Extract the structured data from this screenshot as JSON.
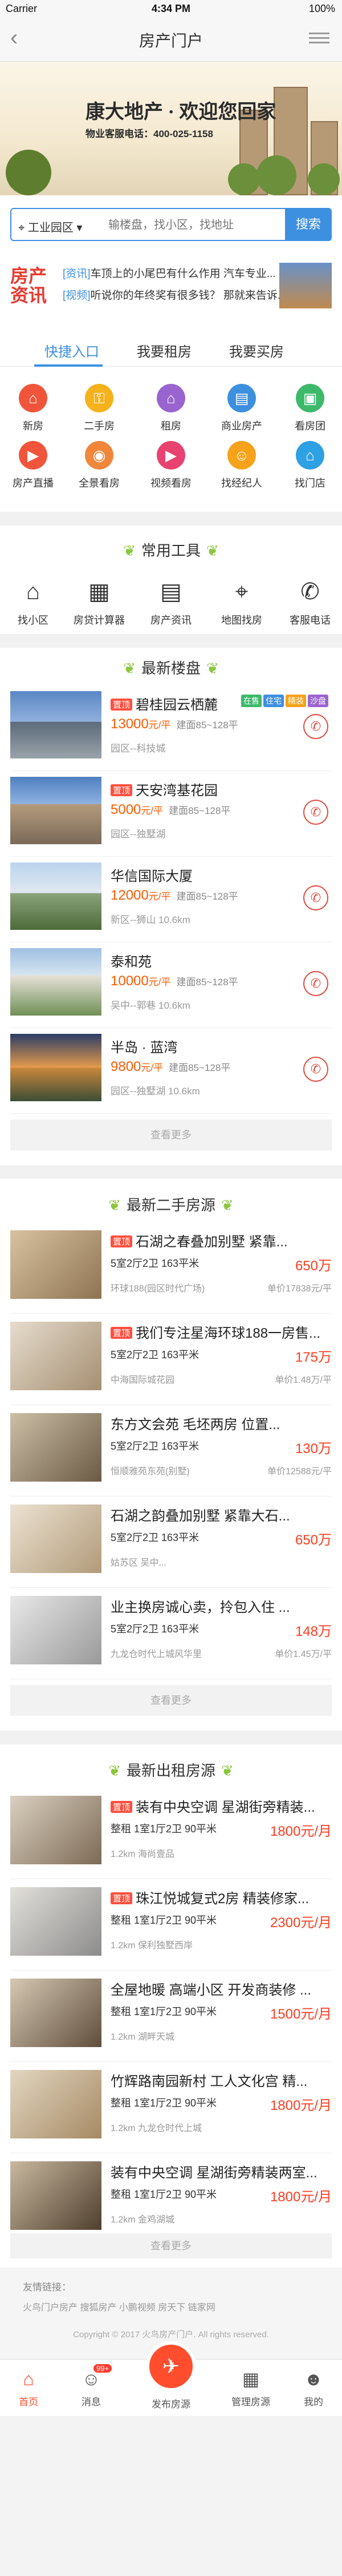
{
  "status": {
    "carrier": "Carrier",
    "time": "4:34 PM",
    "battery": "100%"
  },
  "nav": {
    "title": "房产门户",
    "back": "‹"
  },
  "banner": {
    "headline": "康大地产 · 欢迎您回家",
    "phone_line": "物业客服电话：400-025-1158"
  },
  "search": {
    "city": "工业园区",
    "placeholder": "输楼盘，找小区，找地址",
    "button": "搜索"
  },
  "news": {
    "logo": "房产资讯",
    "items": [
      {
        "tag": "[资讯]",
        "text": "车顶上的小尾巴有什么作用 汽车专业..."
      },
      {
        "tag": "[视频]",
        "text": "听说你的年终奖有很多钱？ 那就来告诉..."
      }
    ]
  },
  "tabs": [
    "快捷入口",
    "我要租房",
    "我要买房"
  ],
  "quick_icons": [
    {
      "label": "新房",
      "icon": "house-icon",
      "color": "#f0553b"
    },
    {
      "label": "二手房",
      "icon": "key-icon",
      "color": "#f6b21b"
    },
    {
      "label": "租房",
      "icon": "rent-icon",
      "color": "#9a64d0"
    },
    {
      "label": "商业房产",
      "icon": "shop-icon",
      "color": "#3d90e0"
    },
    {
      "label": "看房团",
      "icon": "bus-icon",
      "color": "#3db96b"
    },
    {
      "label": "房产直播",
      "icon": "live-icon",
      "color": "#f0553b"
    },
    {
      "label": "全景看房",
      "icon": "panorama-icon",
      "color": "#f0873b"
    },
    {
      "label": "视频看房",
      "icon": "video-icon",
      "color": "#e84370"
    },
    {
      "label": "找经纪人",
      "icon": "agent-icon",
      "color": "#f6a21b"
    },
    {
      "label": "找门店",
      "icon": "store-icon",
      "color": "#2ea0e4"
    }
  ],
  "tools": {
    "title": "常用工具",
    "items": [
      {
        "label": "找小区",
        "icon": "community-icon",
        "glyph": "⌂"
      },
      {
        "label": "房贷计算器",
        "icon": "calculator-icon",
        "glyph": "▦"
      },
      {
        "label": "房产资讯",
        "icon": "news-icon",
        "glyph": "▤"
      },
      {
        "label": "地图找房",
        "icon": "map-pin-icon",
        "glyph": "⌖"
      },
      {
        "label": "客服电话",
        "icon": "phone-icon",
        "glyph": "✆"
      }
    ]
  },
  "new_homes": {
    "title": "最新楼盘",
    "more": "查看更多",
    "items": [
      {
        "name": "碧桂园云栖麓",
        "hot": "置顶",
        "price": "13000",
        "unit": "元/平",
        "spec": "建面85~128平",
        "loc": "园区--科技城",
        "badges": [
          {
            "t": "在售",
            "c": "#3db96b"
          },
          {
            "t": "住宅",
            "c": "#3d90e0"
          },
          {
            "t": "精装",
            "c": "#f6a21b"
          },
          {
            "t": "沙盘",
            "c": "#9a64d0"
          }
        ]
      },
      {
        "name": "天安湾基花园",
        "hot": "置顶",
        "price": "5000",
        "unit": "元/平",
        "spec": "建面85~128平",
        "loc": "园区--独墅湖",
        "badges": []
      },
      {
        "name": "华信国际大厦",
        "hot": "",
        "price": "12000",
        "unit": "元/平",
        "spec": "建面85~128平",
        "loc": "新区--狮山    10.6km",
        "badges": []
      },
      {
        "name": "泰和苑",
        "hot": "",
        "price": "10000",
        "unit": "元/平",
        "spec": "建面85~128平",
        "loc": "吴中--郭巷    10.6km",
        "badges": []
      },
      {
        "name": "半岛 · 蓝湾",
        "hot": "",
        "price": "9800",
        "unit": "元/平",
        "spec": "建面85~128平",
        "loc": "园区--独墅湖    10.6km",
        "badges": []
      }
    ]
  },
  "second_homes": {
    "title": "最新二手房源",
    "more": "查看更多",
    "items": [
      {
        "hot": "置顶",
        "name": "石湖之春叠加别墅 紧靠...",
        "spec": "5室2厅2卫  163平米",
        "price": "650万",
        "loc": "环球188(园区时代广场)",
        "uprice": "单价17838元/平"
      },
      {
        "hot": "置顶",
        "name": "我们专注星海环球188一房售...",
        "spec": "5室2厅2卫  163平米",
        "price": "175万",
        "loc": "中海国际城花园",
        "uprice": "单价1.48万/平"
      },
      {
        "hot": "",
        "name": "东方文会苑 毛坯两房 位置...",
        "spec": "5室2厅2卫  163平米",
        "price": "130万",
        "loc": "恒顺雅苑东苑(别墅)",
        "uprice": "单价12588元/平"
      },
      {
        "hot": "",
        "name": "石湖之韵叠加别墅 紧靠大石...",
        "spec": "5室2厅2卫  163平米",
        "price": "650万",
        "loc": "姑苏区 吴中...",
        "uprice": ""
      },
      {
        "hot": "",
        "name": "业主换房诚心卖，拎包入住 ...",
        "spec": "5室2厅2卫  163平米",
        "price": "148万",
        "loc": "九龙仓时代上城风华里",
        "uprice": "单价1.45万/平"
      }
    ]
  },
  "rent_homes": {
    "title": "最新出租房源",
    "more": "查看更多",
    "items": [
      {
        "hot": "置顶",
        "name": "装有中央空调 星湖街旁精装...",
        "spec": "整租  1室1厅2卫  90平米",
        "price": "1800元/月",
        "loc": "1.2km  海尚壹品"
      },
      {
        "hot": "置顶",
        "name": "珠江悦城复式2房 精装修家...",
        "spec": "整租  1室1厅2卫  90平米",
        "price": "2300元/月",
        "loc": "1.2km  保利独墅西岸"
      },
      {
        "hot": "",
        "name": "全屋地暖 高端小区 开发商装修 ...",
        "spec": "整租  1室1厅2卫  90平米",
        "price": "1500元/月",
        "loc": "1.2km  湖畔天城"
      },
      {
        "hot": "",
        "name": "竹辉路南园新村 工人文化宫 精...",
        "spec": "整租  1室1厅2卫  90平米",
        "price": "1800元/月",
        "loc": "1.2km  九龙仓时代上城"
      },
      {
        "hot": "",
        "name": "装有中央空调 星湖街旁精装两室...",
        "spec": "整租  1室1厅2卫  90平米",
        "price": "1800元/月",
        "loc": "1.2km  金鸡湖城"
      }
    ]
  },
  "footer": {
    "links_title": "友情链接：",
    "links": "火鸟门户房产   搜狐房产   小鹏视频   房天下   链家网",
    "copyright": "Copyright © 2017 火鸟房产门户. All rights reserved."
  },
  "tabbar": {
    "items": [
      {
        "label": "首页",
        "glyph": "⌂",
        "icon": "home-icon"
      },
      {
        "label": "消息",
        "glyph": "☺",
        "icon": "message-icon",
        "badge": "99+"
      },
      {
        "label": "发布房源",
        "glyph": "✈",
        "icon": "publish-icon"
      },
      {
        "label": "管理房源",
        "glyph": "▦",
        "icon": "manage-icon"
      },
      {
        "label": "我的",
        "glyph": "☻",
        "icon": "profile-icon"
      }
    ]
  }
}
